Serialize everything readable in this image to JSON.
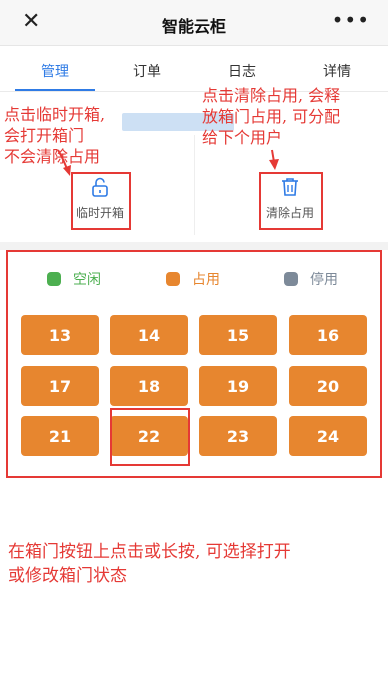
{
  "topbar": {
    "close_glyph": "✕",
    "title": "智能云柜",
    "more_glyph": "•••"
  },
  "tabs": [
    {
      "label": "管理",
      "active": true
    },
    {
      "label": "订单",
      "active": false
    },
    {
      "label": "日志",
      "active": false
    },
    {
      "label": "详情",
      "active": false
    }
  ],
  "actions": {
    "temp_open": {
      "label": "临时开箱",
      "icon": "unlock-icon"
    },
    "clear_occupied": {
      "label": "清除占用",
      "icon": "trash-icon"
    }
  },
  "annotations": {
    "left_line1": "点击临时开箱,",
    "left_line2": "会打开箱门",
    "left_line3": "不会清除占用",
    "right_line1": "点击清除占用, 会释",
    "right_line2": "放箱门占用, 可分配",
    "right_line3": "给下个用户",
    "bottom_line1": "在箱门按钮上点击或长按, 可选择打开",
    "bottom_line2": "或修改箱门状态"
  },
  "legend": [
    {
      "label": "空闲",
      "color": "#4caf50",
      "text_color": "#4caf50"
    },
    {
      "label": "占用",
      "color": "#e7862f",
      "text_color": "#e7862f"
    },
    {
      "label": "停用",
      "color": "#7d8a99",
      "text_color": "#7d8a99"
    }
  ],
  "doors": [
    "13",
    "14",
    "15",
    "16",
    "17",
    "18",
    "19",
    "20",
    "21",
    "22",
    "23",
    "24"
  ],
  "colors": {
    "occupied": "#e7862f",
    "accent": "#2f7be5",
    "annotation": "#e53935"
  }
}
